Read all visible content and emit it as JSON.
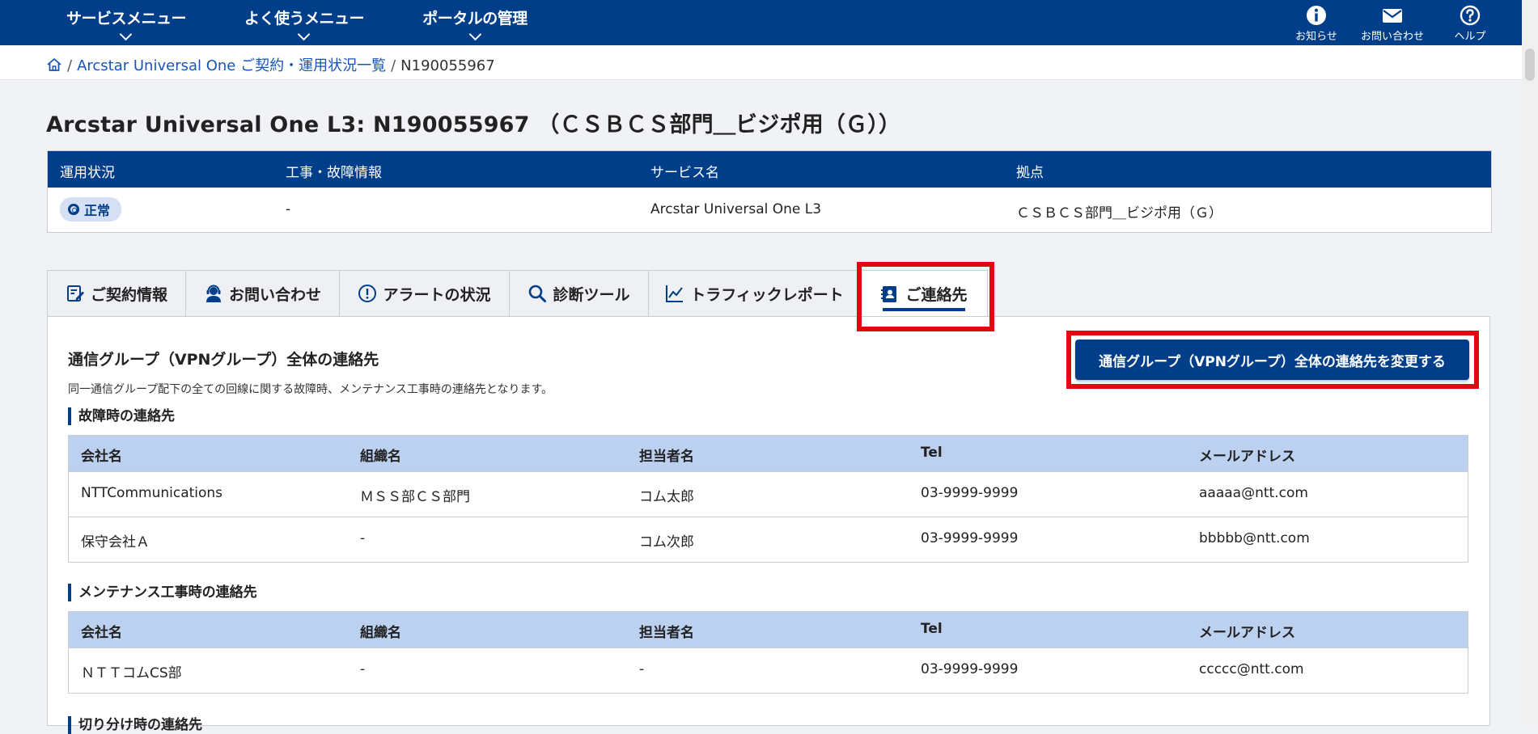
{
  "nav": {
    "menus": [
      "サービスメニュー",
      "よく使うメニュー",
      "ポータルの管理"
    ],
    "utils": [
      {
        "icon": "info-icon",
        "label": "お知らせ"
      },
      {
        "icon": "mail-icon",
        "label": "お問い合わせ"
      },
      {
        "icon": "help-icon",
        "label": "ヘルプ"
      }
    ]
  },
  "breadcrumb": {
    "home_icon": "home-icon",
    "link": "Arcstar Universal One ご契約・運用状況一覧",
    "current": "N190055967"
  },
  "page_title": "Arcstar Universal One L3: N190055967 （ＣＳＢＣＳ部門＿ビジポ用（Ｇ））",
  "summary": {
    "headers": [
      "運用状況",
      "工事・故障情報",
      "サービス名",
      "拠点"
    ],
    "status": "正常",
    "status_color": "#d5e0f4",
    "construction": "-",
    "service": "Arcstar Universal One L3",
    "site": "ＣＳＢＣＳ部門＿ビジポ用（Ｇ）"
  },
  "tabs": [
    {
      "label": "ご契約情報",
      "icon": "contract-icon"
    },
    {
      "label": "お問い合わせ",
      "icon": "support-person-icon"
    },
    {
      "label": "アラートの状況",
      "icon": "alert-icon"
    },
    {
      "label": "診断ツール",
      "icon": "search-icon"
    },
    {
      "label": "トラフィックレポート",
      "icon": "chart-icon"
    },
    {
      "label": "ご連絡先",
      "icon": "contact-book-icon",
      "active": true
    }
  ],
  "section": {
    "title": "通信グループ（VPNグループ）全体の連絡先",
    "description": "同一通信グループ配下の全ての回線に関する故障時、メンテナンス工事時の連絡先となります。",
    "change_button": "通信グループ（VPNグループ）全体の連絡先を変更する"
  },
  "columns": [
    "会社名",
    "組織名",
    "担当者名",
    "Tel",
    "メールアドレス"
  ],
  "fault_contacts": {
    "title": "故障時の連絡先",
    "rows": [
      [
        "NTTCommunications",
        "ＭＳＳ部ＣＳ部門",
        "コム太郎",
        "03-9999-9999",
        "aaaaa@ntt.com"
      ],
      [
        "保守会社Ａ",
        "-",
        "コム次郎",
        "03-9999-9999",
        "bbbbb@ntt.com"
      ]
    ]
  },
  "maintenance_contacts": {
    "title": "メンテナンス工事時の連絡先",
    "rows": [
      [
        "ＮＴＴコムCS部",
        "-",
        "-",
        "03-9999-9999",
        "ccccc@ntt.com"
      ]
    ]
  },
  "isolation_contacts": {
    "title": "切り分け時の連絡先"
  },
  "colors": {
    "brand": "#003e8a",
    "highlight": "#e30613",
    "table_header": "#bcd0f0"
  }
}
